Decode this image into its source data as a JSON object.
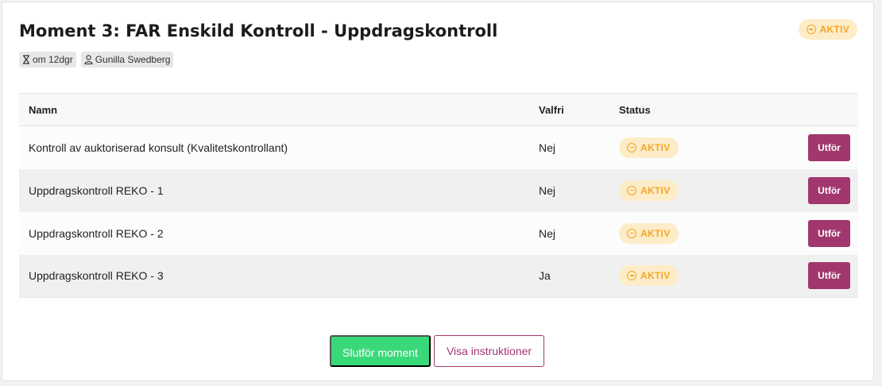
{
  "header": {
    "title": "Moment 3: FAR Enskild Kontroll - Uppdragskontroll",
    "status_badge": "AKTIV",
    "deadline": "om 12dgr",
    "assignee": "Gunilla Swedberg"
  },
  "table": {
    "columns": [
      "Namn",
      "Valfri",
      "Status",
      ""
    ],
    "rows": [
      {
        "name": "Kontroll av auktoriserad konsult (Kvalitetskontrollant)",
        "optional": "Nej",
        "status": "AKTIV",
        "action": "Utför"
      },
      {
        "name": "Uppdragskontroll REKO - 1",
        "optional": "Nej",
        "status": "AKTIV",
        "action": "Utför"
      },
      {
        "name": "Uppdragskontroll REKO - 2",
        "optional": "Nej",
        "status": "AKTIV",
        "action": "Utför"
      },
      {
        "name": "Uppdragskontroll REKO - 3",
        "optional": "Ja",
        "status": "AKTIV",
        "action": "Utför"
      }
    ]
  },
  "footer": {
    "complete_label": "Slutför moment",
    "instructions_label": "Visa instruktioner"
  },
  "icons": {
    "deadline": "hourglass-icon",
    "assignee": "user-icon",
    "status": "minus-circle-icon"
  },
  "colors": {
    "accent": "#a1376d",
    "success": "#39d879",
    "status_active_text": "#f5a623",
    "status_active_bg": "#fdecc8"
  }
}
